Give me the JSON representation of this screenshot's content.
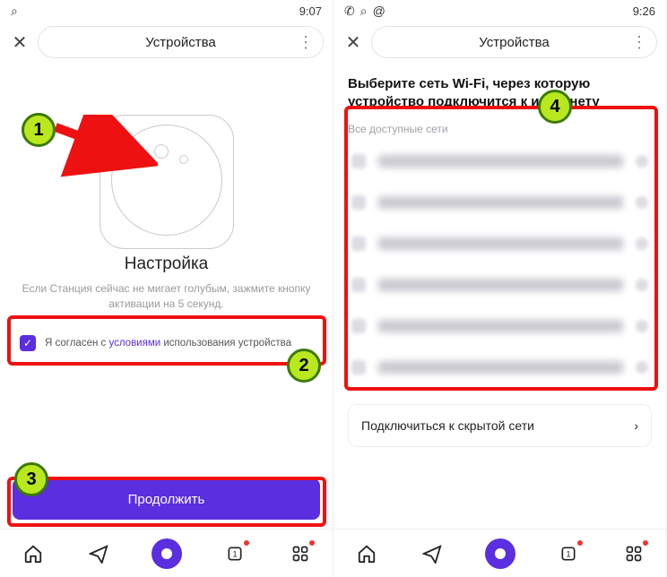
{
  "left": {
    "status": {
      "time": "9:07"
    },
    "header": {
      "title": "Устройства"
    },
    "setup": {
      "title": "Настройка",
      "subtitle": "Если Станция сейчас не мигает голубым, зажмите кнопку активации на 5 секунд.",
      "terms_prefix": "Я согласен с ",
      "terms_link": "условиями",
      "terms_suffix": " использования устройства"
    },
    "continue_label": "Продолжить"
  },
  "right": {
    "status": {
      "time": "9:26"
    },
    "header": {
      "title": "Устройства"
    },
    "wifi": {
      "heading": "Выберите сеть Wi-Fi, через которую устройство подключится к интернету",
      "all_networks_label": "Все доступные сети",
      "hidden_label": "Подключиться к скрытой сети"
    }
  },
  "annotations": {
    "b1": "1",
    "b2": "2",
    "b3": "3",
    "b4": "4"
  }
}
